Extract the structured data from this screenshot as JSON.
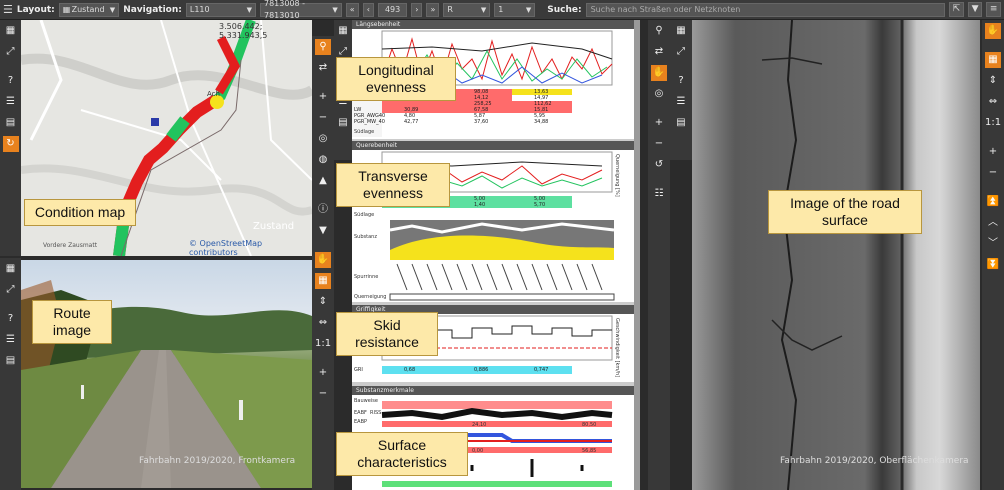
{
  "toolbar": {
    "layout_label": "Layout:",
    "layout_value": "Zustand",
    "navigation_label": "Navigation:",
    "navigation_value": "L110",
    "segment_value": "7813008 - 7813010",
    "distance_value": "493",
    "direction_value": "R",
    "lane_value": "1",
    "search_label": "Suche:",
    "search_placeholder": "Suche nach Straßen oder Netzknoten"
  },
  "map": {
    "coords": "3.506.442; 5.331.943,5",
    "legend_label": "Zustand",
    "attribution": "© OpenStreetMap contributors",
    "place_labels": [
      "Vordere Zausmatt",
      "Ach"
    ]
  },
  "front_camera": {
    "caption": "Fahrbahn 2019/2020, Frontkamera"
  },
  "surface_camera": {
    "caption": "Fahrbahn 2019/2020, Oberflächenkamera"
  },
  "charts": {
    "longitudinal": {
      "title": "Längsebenheit",
      "table_rows": [
        {
          "label": "",
          "values": [
            "",
            "98,08",
            "13,63"
          ]
        },
        {
          "label": "",
          "values": [
            "",
            "14,12",
            "14,97"
          ]
        },
        {
          "label": "",
          "values": [
            "",
            "258,25",
            "112,62"
          ]
        },
        {
          "label": "LW",
          "values": [
            "30,89",
            "67,58",
            "15,81"
          ]
        },
        {
          "label": "PGR_AWG40",
          "values": [
            "4,80",
            "5,87",
            "5,95"
          ]
        },
        {
          "label": "PGR_MW_40",
          "values": [
            "42,77",
            "37,60",
            "34,88"
          ]
        }
      ],
      "footer": "Südlage"
    },
    "transverse": {
      "title": "Querebenheit",
      "right_label": "Querneigung [%]",
      "rows": [
        {
          "label": "",
          "values": [
            "",
            "5,00",
            "5,00"
          ]
        },
        {
          "label": "SPH",
          "values": [
            "1,40",
            "1,40",
            "5,70"
          ]
        }
      ],
      "section_labels": [
        "Südlage",
        "Substanz",
        "Spurrinne",
        "Querneigung"
      ]
    },
    "skid": {
      "title": "Griffigkeit",
      "right_label": "Geschwindigkeit [km/h]",
      "rows": [
        {
          "label": "GRI",
          "values": [
            "0,68",
            "0,886",
            "0,747"
          ]
        }
      ]
    },
    "surface": {
      "title": "Substanzmerkmale",
      "row_labels": [
        "Bauweise",
        "EABF",
        "EABP",
        "RISS"
      ],
      "rows": [
        {
          "values": [
            "24,10",
            "",
            "80,50"
          ]
        },
        {
          "values": [
            "0,00",
            "",
            "56,85"
          ]
        }
      ]
    }
  },
  "callouts": {
    "condition_map": "Condition map",
    "route_image": "Route image",
    "longitudinal": "Longitudinal evenness",
    "transverse": "Transverse evenness",
    "skid": "Skid resistance",
    "surface": "Surface characteristics",
    "road_surface": "Image of the road surface"
  },
  "colors": {
    "accent": "#e8821e",
    "bad": "#e31e1e",
    "good": "#22c35e",
    "warn": "#f5e21c",
    "toolbar": "#3a3a3a"
  }
}
